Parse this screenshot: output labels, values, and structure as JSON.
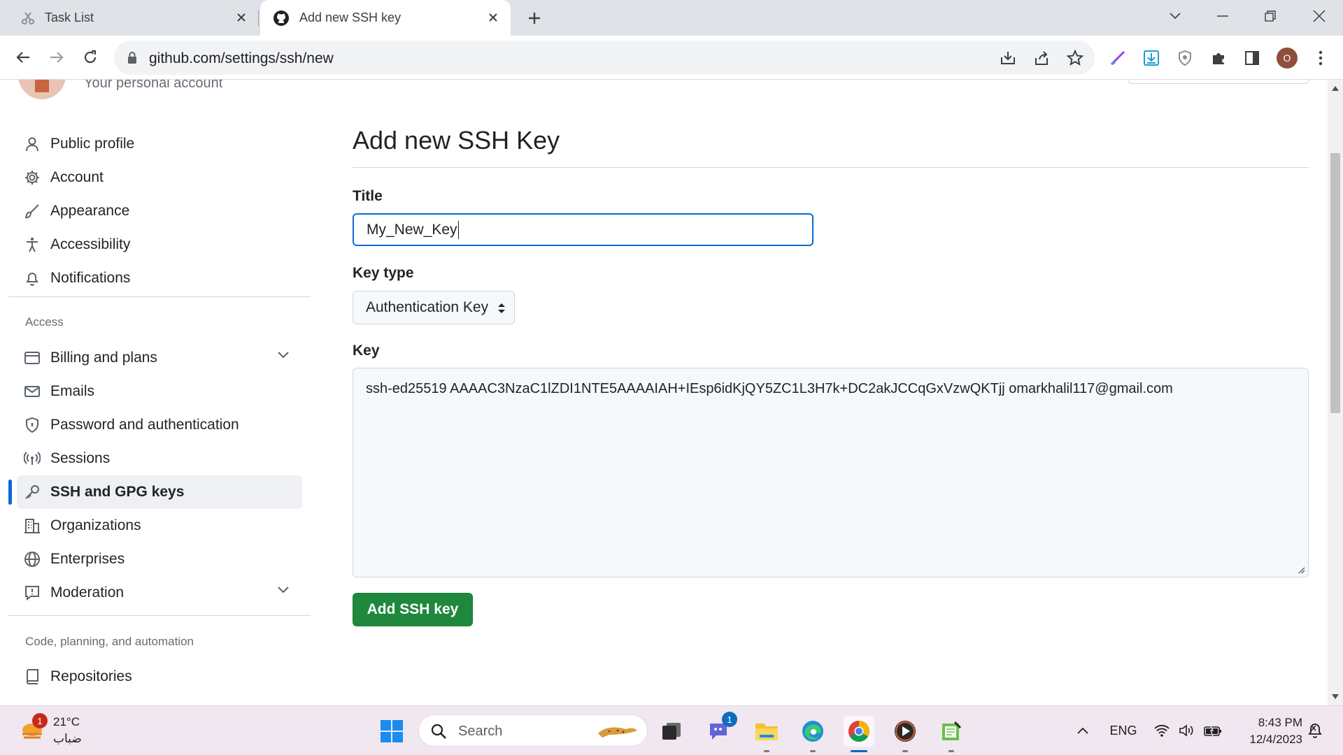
{
  "browser": {
    "tabs": [
      {
        "title": "Task List",
        "icon": "scissors-icon"
      },
      {
        "title": "Add new SSH key",
        "icon": "github-icon"
      }
    ],
    "url": "github.com/settings/ssh/new",
    "profile_initial": "O"
  },
  "header": {
    "account_subtitle": "Your personal account"
  },
  "sidebar": {
    "items": [
      {
        "label": "Public profile",
        "icon": "person-icon"
      },
      {
        "label": "Account",
        "icon": "gear-icon"
      },
      {
        "label": "Appearance",
        "icon": "paintbrush-icon"
      },
      {
        "label": "Accessibility",
        "icon": "accessibility-icon"
      },
      {
        "label": "Notifications",
        "icon": "bell-icon"
      }
    ],
    "access_heading": "Access",
    "access_items": [
      {
        "label": "Billing and plans",
        "icon": "credit-card-icon",
        "expandable": true
      },
      {
        "label": "Emails",
        "icon": "mail-icon"
      },
      {
        "label": "Password and authentication",
        "icon": "shield-lock-icon"
      },
      {
        "label": "Sessions",
        "icon": "broadcast-icon"
      },
      {
        "label": "SSH and GPG keys",
        "icon": "key-icon",
        "active": true
      },
      {
        "label": "Organizations",
        "icon": "organization-icon"
      },
      {
        "label": "Enterprises",
        "icon": "globe-icon"
      },
      {
        "label": "Moderation",
        "icon": "report-icon",
        "expandable": true
      }
    ],
    "code_heading": "Code, planning, and automation",
    "code_items": [
      {
        "label": "Repositories",
        "icon": "repo-icon"
      }
    ]
  },
  "main": {
    "title": "Add new SSH Key",
    "title_label": "Title",
    "title_value": "My_New_Key",
    "key_type_label": "Key type",
    "key_type_value": "Authentication Key",
    "key_label": "Key",
    "key_value": "ssh-ed25519 AAAAC3NzaC1lZDI1NTE5AAAAIAH+IEsp6idKjQY5ZC1L3H7k+DC2akJCCqGxVzwQKTjj omarkhalil117@gmail.com",
    "submit_label": "Add SSH key"
  },
  "taskbar": {
    "weather_badge": "1",
    "temperature": "21°C",
    "weather_desc": "ضباب",
    "search_placeholder": "Search",
    "chat_badge": "1",
    "language": "ENG",
    "time": "8:43 PM",
    "date": "12/4/2023"
  },
  "colors": {
    "accent": "#0969da",
    "submit": "#1f883d",
    "taskbar": "#f0e7f1"
  }
}
